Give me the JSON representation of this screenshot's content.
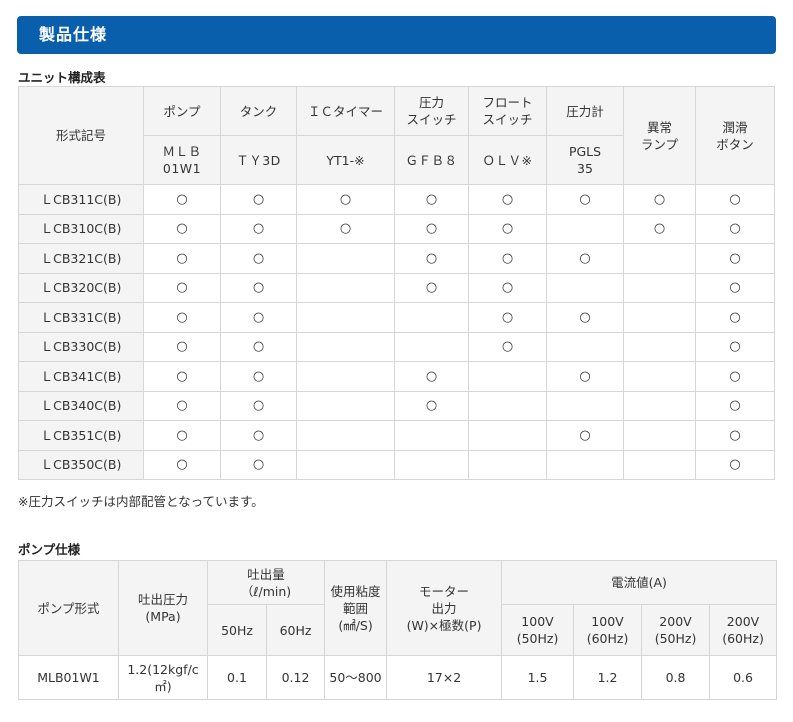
{
  "banner": {
    "title": "製品仕様"
  },
  "unit_table": {
    "heading": "ユニット構成表",
    "row_header": "形式記号",
    "columns": [
      {
        "name": "ポンプ",
        "model": "ＭＬＢ\n01W1"
      },
      {
        "name": "タンク",
        "model": "ＴＹ3D"
      },
      {
        "name": "ＩＣタイマー",
        "model": "YT1-※"
      },
      {
        "name": "圧力\nスイッチ",
        "model": "ＧＦＢ８"
      },
      {
        "name": "フロート\nスイッチ",
        "model": "ＯＬＶ※"
      },
      {
        "name": "圧力計",
        "model": "PGLS\n35"
      },
      {
        "name": "異常\nランプ",
        "model": ""
      },
      {
        "name": "潤滑\nボタン",
        "model": ""
      }
    ],
    "rows": [
      {
        "model": "ＬCB311C(B)",
        "cells": [
          "○",
          "○",
          "○",
          "○",
          "○",
          "○",
          "○",
          "○"
        ]
      },
      {
        "model": "ＬCB310C(B)",
        "cells": [
          "○",
          "○",
          "○",
          "○",
          "○",
          "",
          "○",
          "○"
        ]
      },
      {
        "model": "ＬCB321C(B)",
        "cells": [
          "○",
          "○",
          "",
          "○",
          "○",
          "○",
          "",
          "○"
        ]
      },
      {
        "model": "ＬCB320C(B)",
        "cells": [
          "○",
          "○",
          "",
          "○",
          "○",
          "",
          "",
          "○"
        ]
      },
      {
        "model": "ＬCB331C(B)",
        "cells": [
          "○",
          "○",
          "",
          "",
          "○",
          "○",
          "",
          "○"
        ]
      },
      {
        "model": "ＬCB330C(B)",
        "cells": [
          "○",
          "○",
          "",
          "",
          "○",
          "",
          "",
          "○"
        ]
      },
      {
        "model": "ＬCB341C(B)",
        "cells": [
          "○",
          "○",
          "",
          "○",
          "",
          "○",
          "",
          "○"
        ]
      },
      {
        "model": "ＬCB340C(B)",
        "cells": [
          "○",
          "○",
          "",
          "○",
          "",
          "",
          "",
          "○"
        ]
      },
      {
        "model": "ＬCB351C(B)",
        "cells": [
          "○",
          "○",
          "",
          "",
          "",
          "○",
          "",
          "○"
        ]
      },
      {
        "model": "ＬCB350C(B)",
        "cells": [
          "○",
          "○",
          "",
          "",
          "",
          "",
          "",
          "○"
        ]
      }
    ],
    "note": "※圧力スイッチは内部配管となっています。"
  },
  "pump_table": {
    "heading": "ポンプ仕様",
    "headers": {
      "pump_type": "ポンプ形式",
      "pressure": "吐出圧力\n(MPa)",
      "discharge": "吐出量\n（ℓ/min)",
      "viscosity": "使用粘度\n範囲\n(㎟/S)",
      "motor": "モーター\n出力\n(W)×極数(P)",
      "current": "電流値(A)",
      "hz50": "50Hz",
      "hz60": "60Hz",
      "current_cols": [
        "100V\n(50Hz)",
        "100V\n(60Hz)",
        "200V\n(50Hz)",
        "200V\n(60Hz)"
      ]
    },
    "row": {
      "pump_type": "MLB01W1",
      "pressure": "1.2(12kgf/c\n㎡)",
      "q50": "0.1",
      "q60": "0.12",
      "viscosity": "50～800",
      "motor": "17×2",
      "currents": [
        "1.5",
        "1.2",
        "0.8",
        "0.6"
      ]
    }
  }
}
